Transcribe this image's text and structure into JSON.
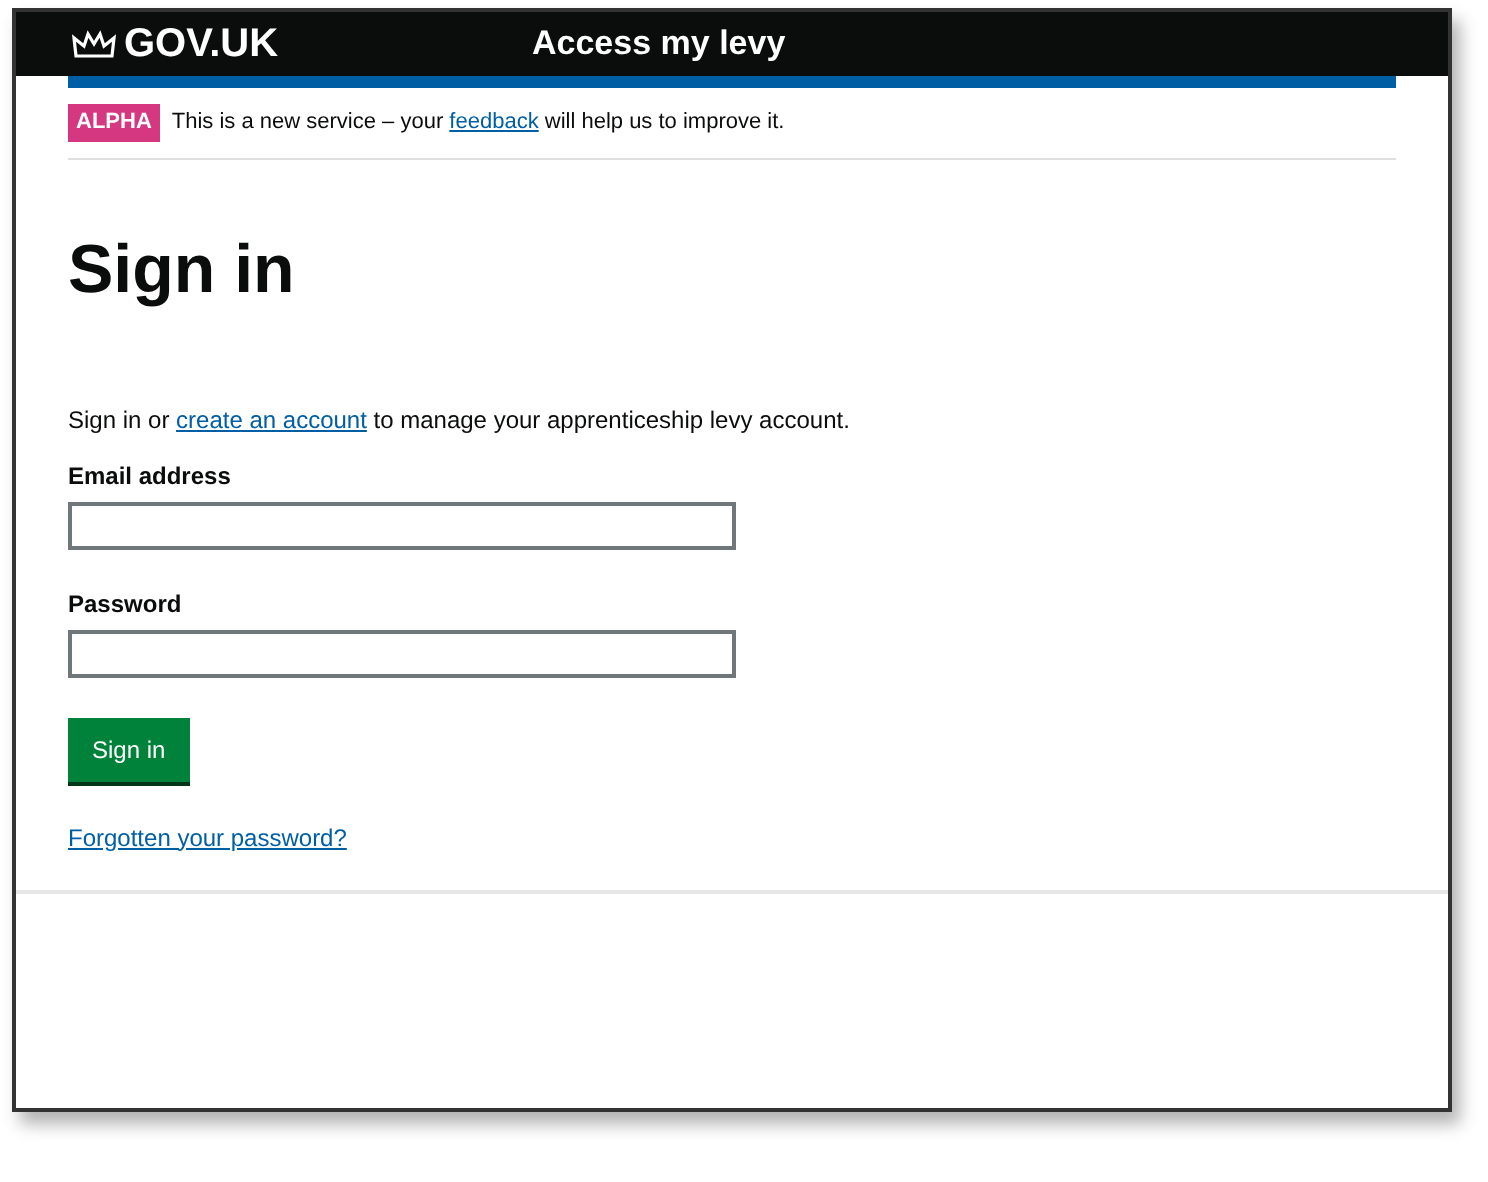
{
  "header": {
    "logo": "GOV.UK",
    "service": "Access my levy"
  },
  "banner": {
    "tag": "ALPHA",
    "before": "This is a new service – your ",
    "link": "feedback",
    "after": " will help us to improve it."
  },
  "title": "Sign in",
  "intro": {
    "before": "Sign in or ",
    "link": "create an account",
    "after": " to manage your apprenticeship levy account."
  },
  "fields": [
    {
      "label": "Email address"
    },
    {
      "label": "Password"
    }
  ],
  "button": "Sign in",
  "forgot_link": "Forgotten your password?"
}
